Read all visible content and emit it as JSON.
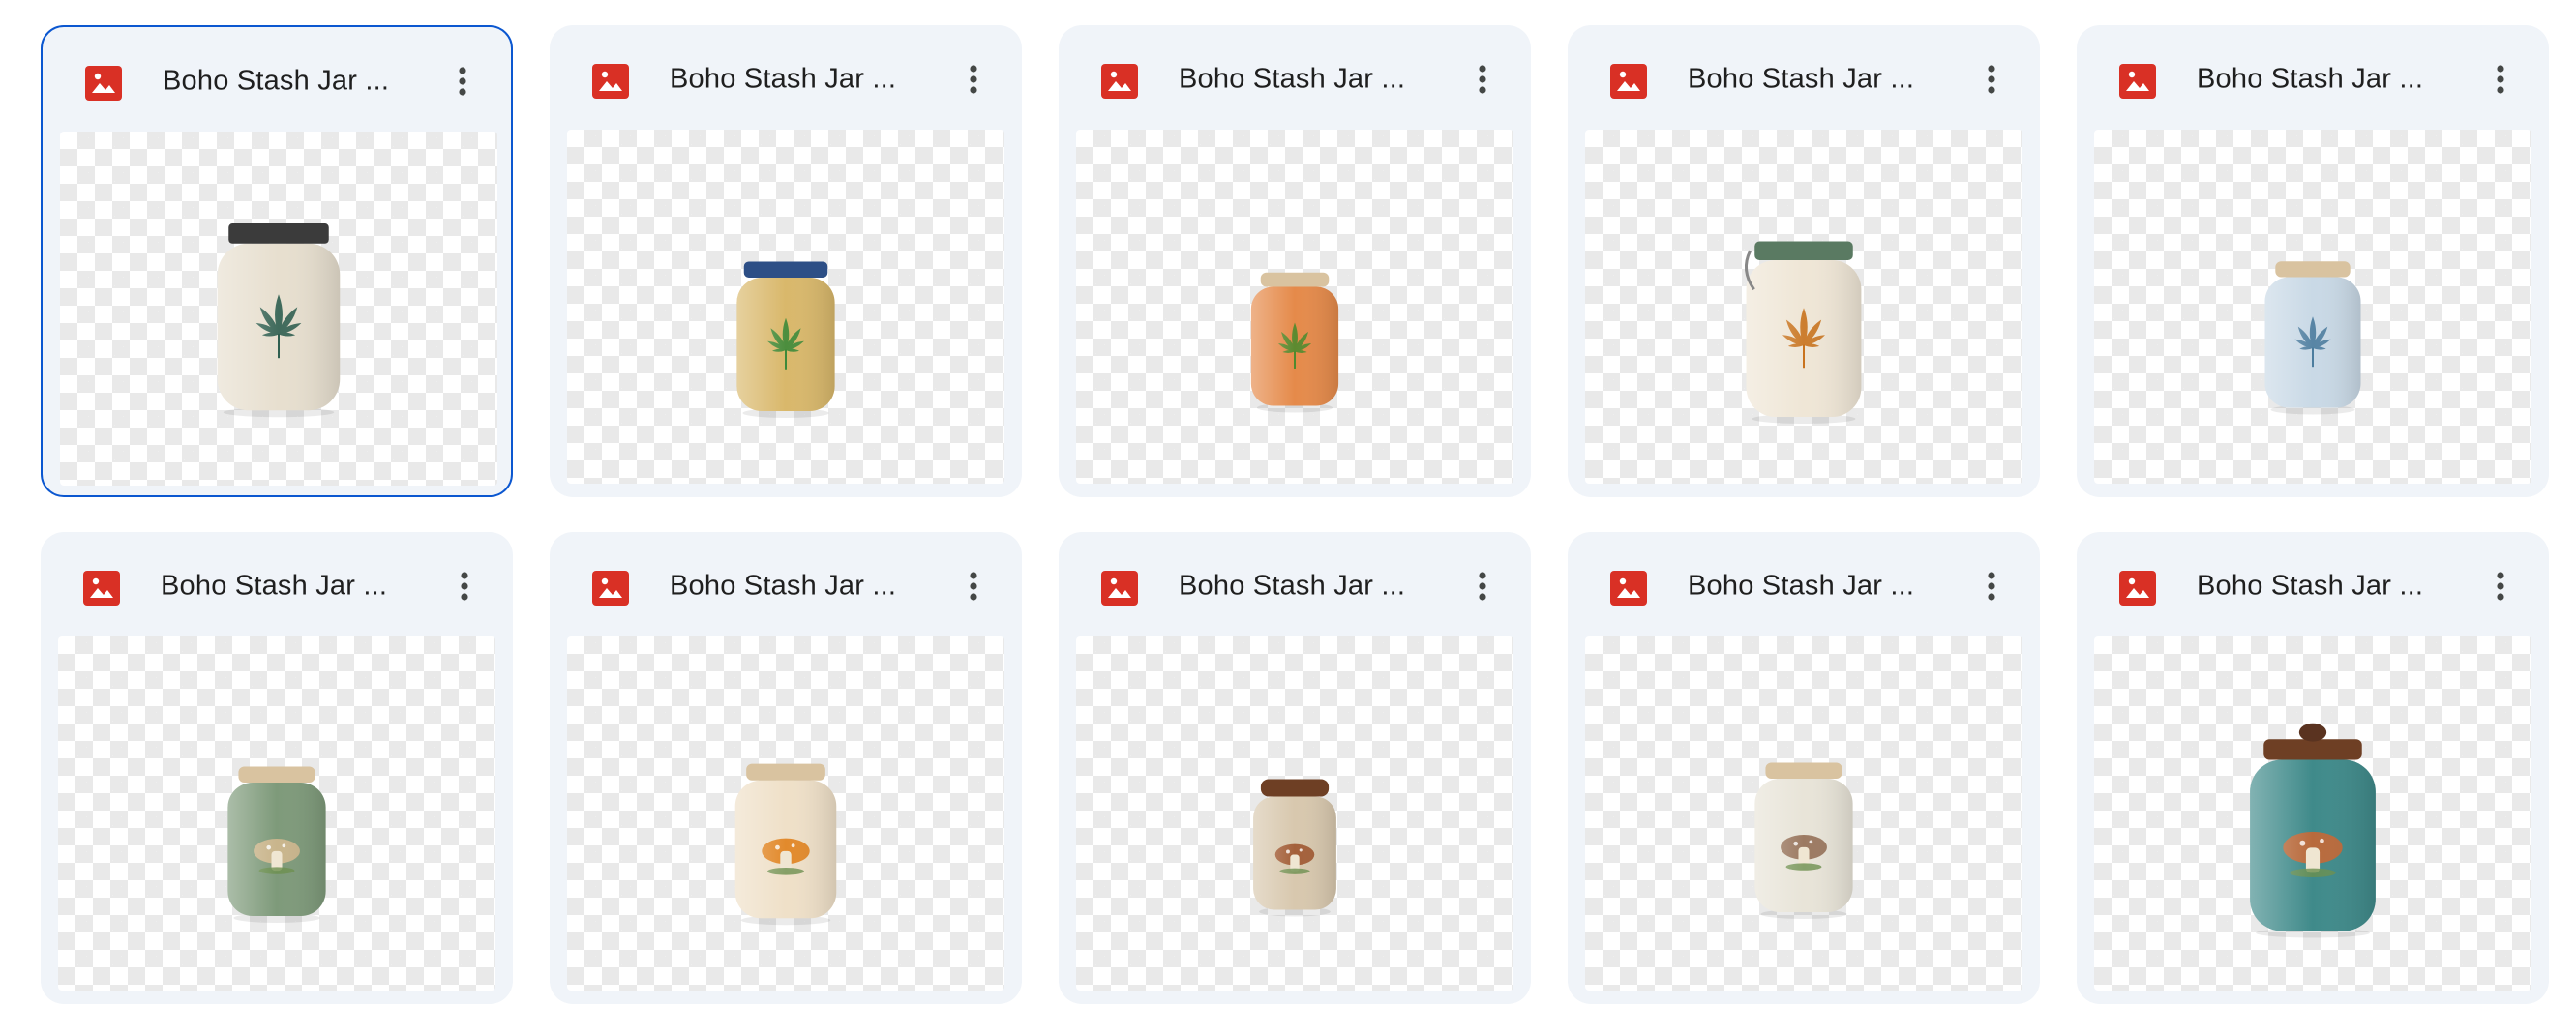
{
  "files": [
    {
      "name": "Boho Stash Jar ...",
      "motif": "leaf",
      "lid": "metal",
      "body": "#e7dfcf",
      "accent": "#2f5f50",
      "selected": true
    },
    {
      "name": "Boho Stash Jar ...",
      "motif": "leaf",
      "lid": "band",
      "body": "#d9b86b",
      "accent": "#3d8a3a",
      "selected": false
    },
    {
      "name": "Boho Stash Jar ...",
      "motif": "leaf",
      "lid": "cork",
      "body": "#e58a4a",
      "accent": "#4f8a2e",
      "selected": false
    },
    {
      "name": "Boho Stash Jar ...",
      "motif": "leaf",
      "lid": "clamp",
      "body": "#efe6d6",
      "accent": "#c9731e",
      "selected": false
    },
    {
      "name": "Boho Stash Jar ...",
      "motif": "leaf",
      "lid": "cork",
      "body": "#c9d9e6",
      "accent": "#4c7d9e",
      "selected": false
    },
    {
      "name": "Boho Stash Jar ...",
      "motif": "mushroom",
      "lid": "cork",
      "body": "#7e9a7a",
      "accent": "#c9b58c",
      "selected": false
    },
    {
      "name": "Boho Stash Jar ...",
      "motif": "mushroom",
      "lid": "cork",
      "body": "#efe0c8",
      "accent": "#e28a2c",
      "selected": false
    },
    {
      "name": "Boho Stash Jar ...",
      "motif": "mushroom",
      "lid": "wood",
      "body": "#d8c8ae",
      "accent": "#a4603a",
      "selected": false
    },
    {
      "name": "Boho Stash Jar ...",
      "motif": "mushroom",
      "lid": "cork",
      "body": "#e8e4d8",
      "accent": "#9c7a62",
      "selected": false
    },
    {
      "name": "Boho Stash Jar ...",
      "motif": "mushroom",
      "lid": "knob",
      "body": "#3f8a8a",
      "accent": "#b86a3c",
      "selected": false
    }
  ],
  "icons": {
    "file_type": "image-file-icon",
    "more": "more-vert-icon",
    "file_icon_color": "#d93025"
  }
}
